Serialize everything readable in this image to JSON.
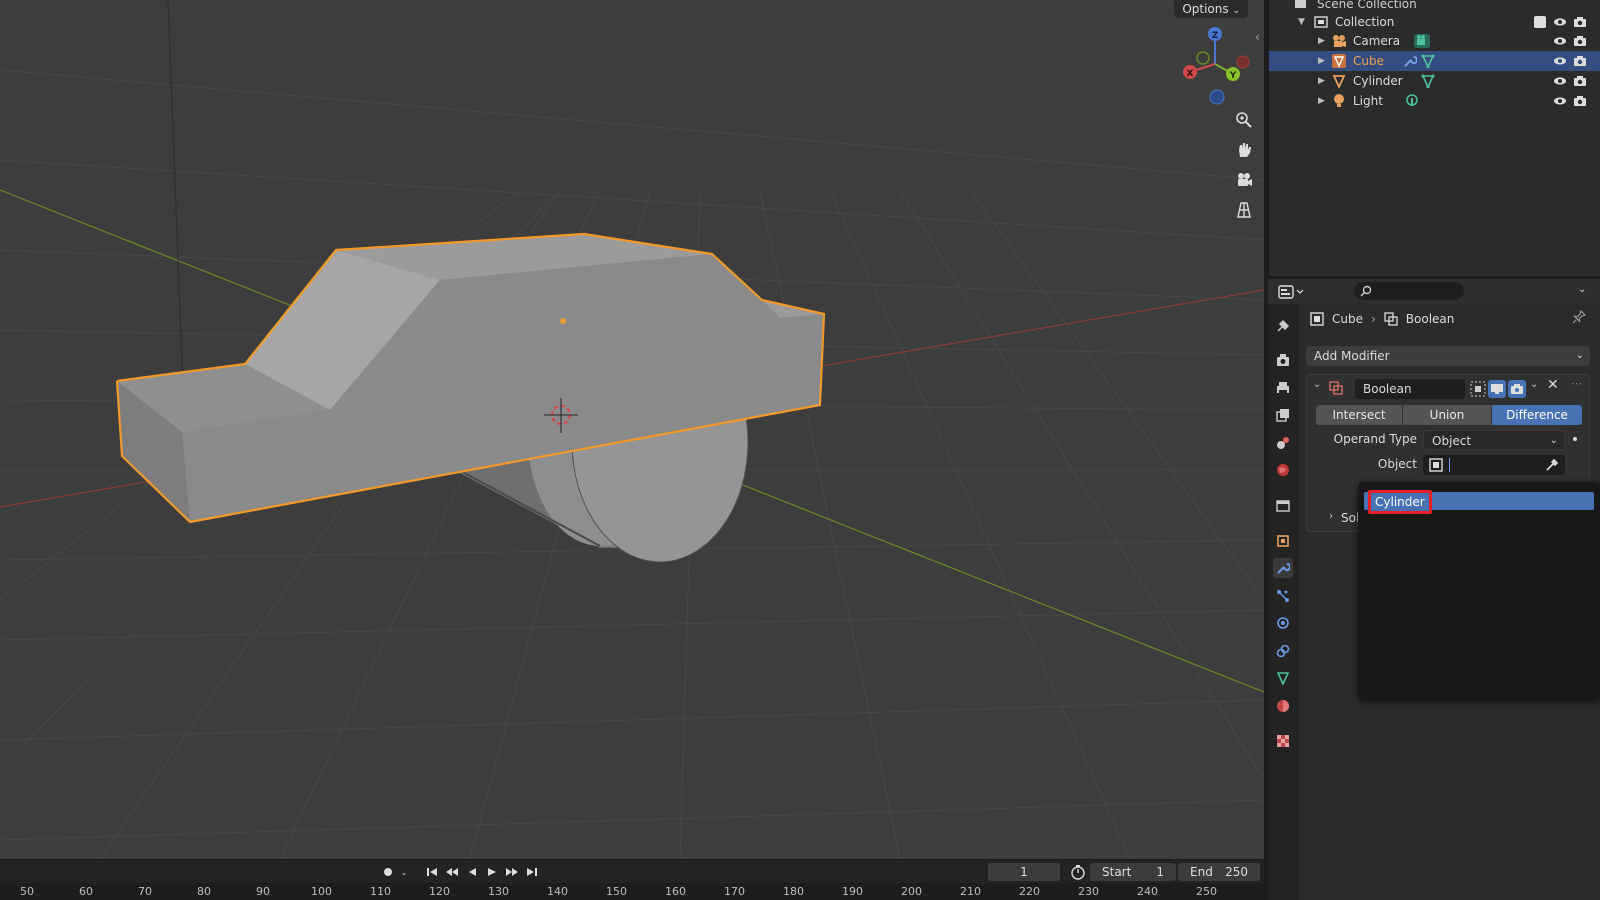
{
  "viewport": {
    "options_label": "Options"
  },
  "gizmo": {
    "x": "X",
    "y": "Y",
    "z": "Z"
  },
  "outliner": {
    "scene_collection": "Scene Collection",
    "collection": "Collection",
    "items": [
      {
        "label": "Camera",
        "color": "#e8a060"
      },
      {
        "label": "Cube",
        "color": "#e8a060",
        "selected": true
      },
      {
        "label": "Cylinder",
        "color": "#e8a060"
      },
      {
        "label": "Light",
        "color": "#e8a060"
      }
    ]
  },
  "properties": {
    "breadcrumb_object": "Cube",
    "breadcrumb_modifier": "Boolean",
    "add_modifier": "Add Modifier",
    "modifier_name": "Boolean",
    "operations": [
      "Intersect",
      "Union",
      "Difference"
    ],
    "active_operation": "Difference",
    "operand_type_label": "Operand Type",
    "operand_type_value": "Object",
    "object_label": "Object",
    "solver_label": "Solv"
  },
  "popup": {
    "items": [
      "Cylinder"
    ]
  },
  "timeline": {
    "current_frame": "1",
    "start_label": "Start",
    "start_value": "1",
    "end_label": "End",
    "end_value": "250",
    "ruler_ticks": [
      "50",
      "60",
      "70",
      "80",
      "90",
      "100",
      "110",
      "120",
      "130",
      "140",
      "150",
      "160",
      "170",
      "180",
      "190",
      "200",
      "210",
      "220",
      "230",
      "240",
      "250"
    ]
  },
  "colors": {
    "selection_blue": "#334d80",
    "active_blue": "#4772b3",
    "outline_orange": "#f09a2a",
    "highlight_red": "#e8202a"
  }
}
